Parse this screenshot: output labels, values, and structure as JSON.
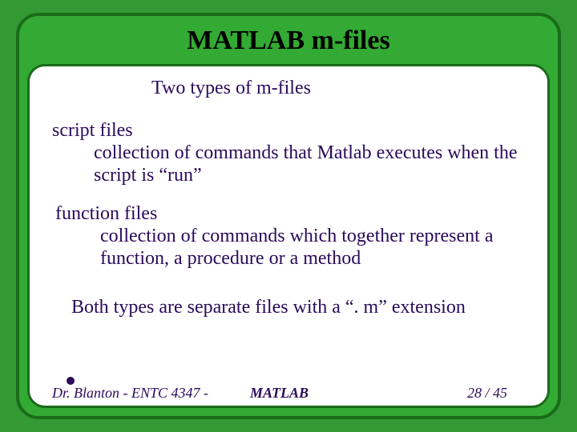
{
  "title": "MATLAB m-files",
  "subtitle": "Two types of m-files",
  "sections": [
    {
      "label": "script files",
      "desc": "collection of commands that Matlab executes when the script is “run”"
    },
    {
      "label": "function files",
      "desc": "collection of commands which together represent a function, a procedure or a method"
    }
  ],
  "bothline": "Both types are separate files with a “. m” extension",
  "footer": {
    "left": "Dr. Blanton  -  ENTC 4347  -",
    "center": "MATLAB",
    "right": "28 / 45"
  }
}
